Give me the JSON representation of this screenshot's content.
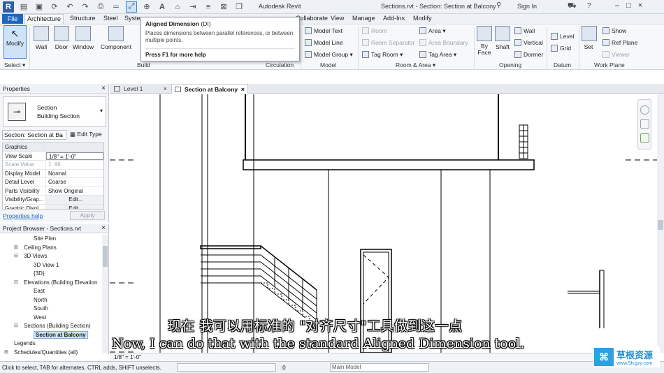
{
  "titlebar": {
    "app": "Autodesk Revit",
    "document": "Sections.rvt - Section: Section at Balcony",
    "signin": "Sign In"
  },
  "ribbon_tabs": [
    "File",
    "Architecture",
    "Structure",
    "Steel",
    "System",
    "Collaborate",
    "View",
    "Manage",
    "Add-Ins",
    "Modify"
  ],
  "ribbon": {
    "modify": "Modify",
    "select": "Select",
    "build_title": "Build",
    "build": [
      "Wall",
      "Door",
      "Window",
      "Component"
    ],
    "circulation_title": "Circulation",
    "model_title": "Model",
    "model": [
      "Model Text",
      "Model Line",
      "Model Group"
    ],
    "room_title": "Room & Area",
    "room": [
      "Room",
      "Room Separator",
      "Tag Room",
      "Area",
      "Area Boundary",
      "Tag Area"
    ],
    "opening_title": "Opening",
    "opening": [
      "By Face",
      "Shaft",
      "Wall",
      "Vertical",
      "Dormer"
    ],
    "datum_title": "Datum",
    "datum": [
      "Level",
      "Grid"
    ],
    "workplane_title": "Work Plane",
    "workplane": [
      "Set",
      "Show",
      "Ref Plane",
      "Viewer"
    ]
  },
  "tooltip": {
    "title": "Aligned Dimension",
    "shortcut": "(DI)",
    "description": "Places dimensions between parallel references, or between multiple points.",
    "help": "Press F1 for more help"
  },
  "properties": {
    "header": "Properties",
    "type_line1": "Section",
    "type_line2": "Building Section",
    "instance": "Section: Section at Ba",
    "edit_type": "Edit Type",
    "rows": [
      {
        "k": "Graphics",
        "v": "",
        "group": true
      },
      {
        "k": "View Scale",
        "v": "1/8\" = 1'-0\""
      },
      {
        "k": "Scale Value",
        "v": "1: 96",
        "disabled": true
      },
      {
        "k": "Display Model",
        "v": "Normal"
      },
      {
        "k": "Detail Level",
        "v": "Coarse"
      },
      {
        "k": "Parts Visibility",
        "v": "Show Original"
      },
      {
        "k": "Visibility/Grap...",
        "v": "Edit..."
      },
      {
        "k": "Graphic Displ...",
        "v": "Edit..."
      }
    ],
    "help_link": "Properties help",
    "apply": "Apply"
  },
  "browser": {
    "header": "Project Browser - Sections.rvt",
    "tree": [
      {
        "label": "Site Plan",
        "indent": 3,
        "tw": ""
      },
      {
        "label": "Ceiling Plans",
        "indent": 2,
        "tw": "+"
      },
      {
        "label": "3D Views",
        "indent": 2,
        "tw": "−"
      },
      {
        "label": "3D View 1",
        "indent": 3,
        "tw": ""
      },
      {
        "label": "{3D}",
        "indent": 3,
        "tw": ""
      },
      {
        "label": "Elevations (Building Elevation",
        "indent": 2,
        "tw": "−"
      },
      {
        "label": "East",
        "indent": 3,
        "tw": ""
      },
      {
        "label": "North",
        "indent": 3,
        "tw": ""
      },
      {
        "label": "South",
        "indent": 3,
        "tw": ""
      },
      {
        "label": "West",
        "indent": 3,
        "tw": ""
      },
      {
        "label": "Sections (Building Section)",
        "indent": 2,
        "tw": "−"
      },
      {
        "label": "Section at Balcony",
        "indent": 3,
        "tw": "",
        "selected": true
      },
      {
        "label": "Legends",
        "indent": 1,
        "tw": ""
      },
      {
        "label": "Schedules/Quantities (all)",
        "indent": 1,
        "tw": "+"
      }
    ]
  },
  "view_tabs": [
    "Level 1",
    "Section at Balcony"
  ],
  "view_scale": "1/8\" = 1'-0\"",
  "subtitles": {
    "zh": "现在 我可以用标准的 \"对齐尺寸\"工具做到这一点",
    "en": "Now, I can do that with the standard Aligned Dimension tool."
  },
  "status": {
    "hint": "Click to select, TAB for alternates, CTRL adds, SHIFT unselects.",
    "zero": ":0",
    "model": "Main Model"
  },
  "watermark": {
    "cn": "草根资源",
    "url": "www.5fcgzy.com"
  },
  "colors": {
    "accent": "#1f66bf",
    "selected": "#cfe3f7"
  }
}
